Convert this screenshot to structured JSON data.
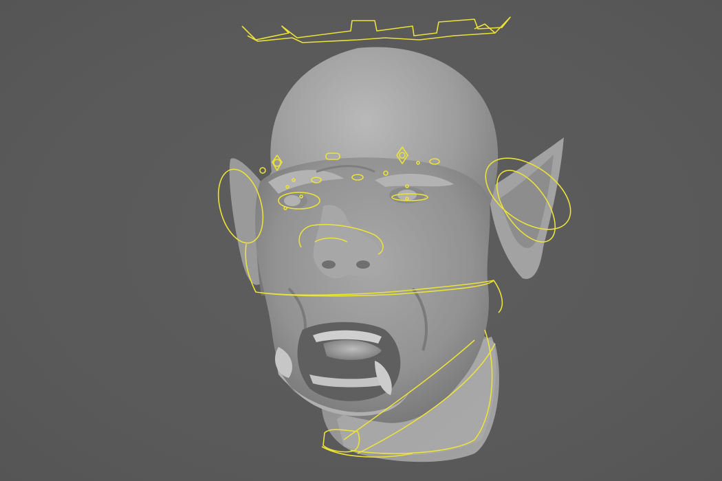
{
  "viewport": {
    "background_color": "#5b5b5b",
    "model": {
      "name": "orc-head-sculpt",
      "shading": "smooth-gray",
      "base_color": "#9a9a9a"
    },
    "rig": {
      "control_color": "#ece338",
      "controls": [
        "head-top-control",
        "left-ear-control",
        "right-ear-control",
        "brow-controls",
        "eye-controls",
        "nose-control",
        "jaw-control",
        "neck-control",
        "chin-control"
      ]
    }
  }
}
